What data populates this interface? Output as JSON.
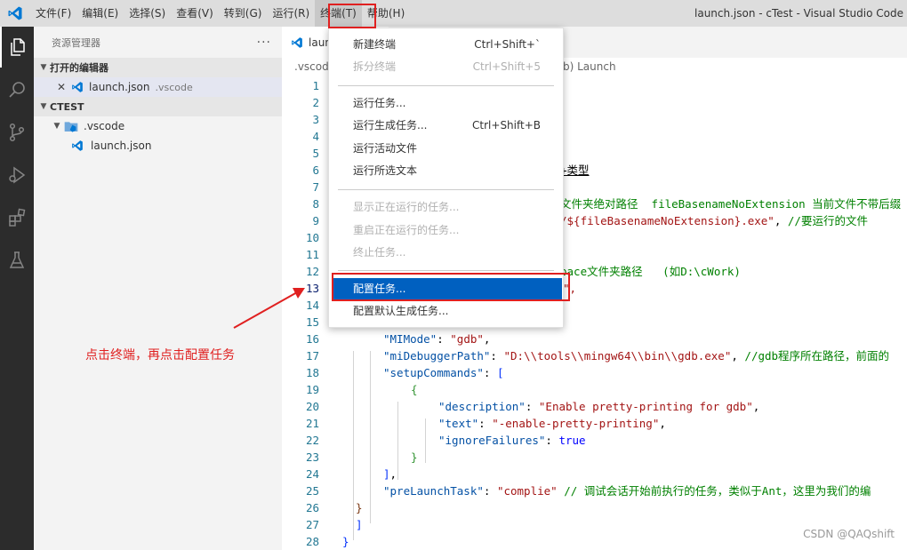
{
  "titlebar": {
    "menus": [
      "文件(F)",
      "编辑(E)",
      "选择(S)",
      "查看(V)",
      "转到(G)",
      "运行(R)",
      "终端(T)",
      "帮助(H)"
    ],
    "window_title": "launch.json - cTest - Visual Studio Code"
  },
  "sidebar": {
    "title": "资源管理器",
    "more": "···",
    "open_editors_label": "打开的编辑器",
    "open_editor_file": "launch.json",
    "open_editor_desc": ".vscode",
    "project_label": "CTEST",
    "folder": ".vscode",
    "file": "launch.json"
  },
  "editor": {
    "tab_label": "launch",
    "breadcrumb": ".vscode",
    "breadcrumb_tail": "b) Launch",
    "line_numbers": [
      "1",
      "2",
      "3",
      "4",
      "5",
      "6",
      "7",
      "8",
      "9",
      "10",
      "11",
      "12",
      "13",
      "14",
      "15",
      "16",
      "17",
      "18",
      "19",
      "20",
      "21",
      "22",
      "23",
      "24",
      "25",
      "26",
      "27",
      "28"
    ],
    "partial": {
      "l6": "+类型",
      "l8": "文件夹绝对路径  fileBasenameNoExtension 当前文件不带后缀",
      "l9a": "/${fileBasenameNoExtension}.exe\"",
      "l9b": ", ",
      "l9c": "//要运行的文件",
      "l12": "pace文件夹路径   (如D:\\cWork)",
      "l13": "\","
    },
    "code": {
      "l16k": "\"MIMode\"",
      "l16v": "\"gdb\"",
      "l17k": "\"miDebuggerPath\"",
      "l17v": "\"D:\\\\tools\\\\mingw64\\\\bin\\\\gdb.exe\"",
      "l17c": "//gdb程序所在路径，前面的",
      "l18k": "\"setupCommands\"",
      "l20k": "\"description\"",
      "l20v": "\"Enable pretty-printing for gdb\"",
      "l21k": "\"text\"",
      "l21v": "\"-enable-pretty-printing\"",
      "l22k": "\"ignoreFailures\"",
      "l22v": "true",
      "l25k": "\"preLaunchTask\"",
      "l25v": "\"complie\"",
      "l25c": "// 调试会话开始前执行的任务，类似于Ant，这里为我们的编"
    }
  },
  "terminal_menu": {
    "items": [
      {
        "label": "新建终端",
        "shortcut": "Ctrl+Shift+`"
      },
      {
        "label": "拆分终端",
        "shortcut": "Ctrl+Shift+5"
      },
      {
        "label": "运行任务..."
      },
      {
        "label": "运行生成任务...",
        "shortcut": "Ctrl+Shift+B"
      },
      {
        "label": "运行活动文件"
      },
      {
        "label": "运行所选文本"
      },
      {
        "label": "显示正在运行的任务..."
      },
      {
        "label": "重启正在运行的任务..."
      },
      {
        "label": "终止任务..."
      },
      {
        "label": "配置任务..."
      },
      {
        "label": "配置默认生成任务..."
      }
    ]
  },
  "annotation": {
    "text": "点击终端，再点击配置任务"
  },
  "watermark": "CSDN @QAQshift",
  "colors": {
    "accent_red": "#e02020",
    "menu_highlight": "#0060c0",
    "activitybar": "#2c2c2c",
    "vscode_blue": "#0078d4"
  }
}
